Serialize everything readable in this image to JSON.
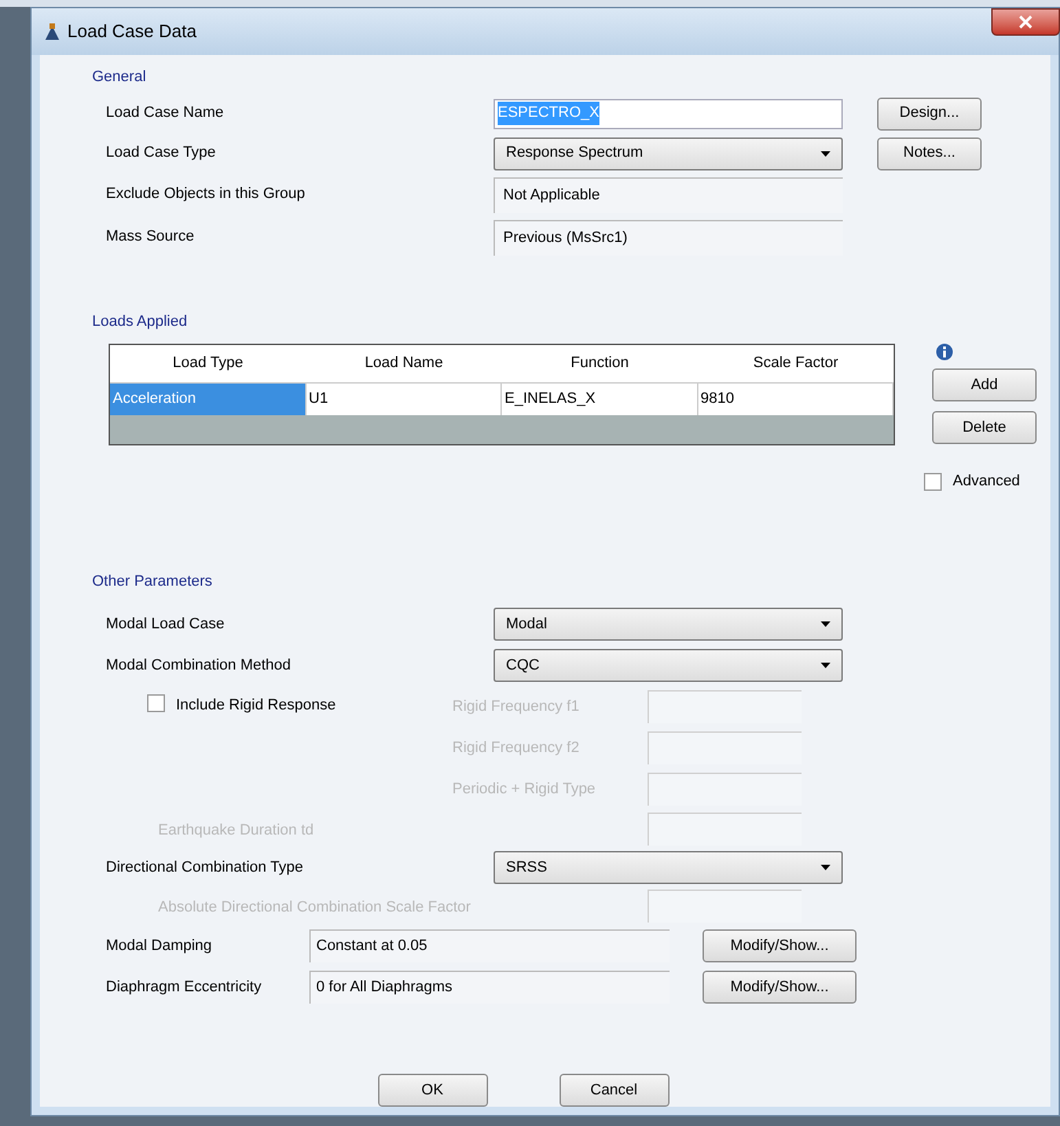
{
  "window": {
    "title": "Load Case Data"
  },
  "general": {
    "title": "General",
    "rows": [
      {
        "kind": "text",
        "label": "Load Case Name",
        "value": "ESPECTRO_X",
        "text_selected": true,
        "button": "Design..."
      },
      {
        "kind": "select",
        "label": "Load Case Type",
        "value": "Response Spectrum",
        "button": "Notes..."
      },
      {
        "kind": "readonly",
        "label": "Exclude Objects in this Group",
        "value": "Not Applicable"
      },
      {
        "kind": "readonly",
        "label": "Mass Source",
        "value": "Previous (MsSrc1)"
      }
    ]
  },
  "loads_applied": {
    "title": "Loads Applied",
    "columns": [
      "Load Type",
      "Load Name",
      "Function",
      "Scale Factor"
    ],
    "rows": [
      {
        "cells": [
          {
            "text": "Acceleration",
            "selected": true
          },
          {
            "text": "U1",
            "selected": false
          },
          {
            "text": "E_INELAS_X",
            "selected": false
          },
          {
            "text": "9810",
            "selected": false
          }
        ]
      }
    ],
    "buttons": [
      "Add",
      "Delete"
    ],
    "advanced": {
      "label": "Advanced",
      "checked": false
    }
  },
  "other_parameters": {
    "title": "Other Parameters",
    "modal_load_case": {
      "label": "Modal Load Case",
      "value": "Modal"
    },
    "modal_combination_method": {
      "label": "Modal Combination Method",
      "value": "CQC"
    },
    "include_rigid_response": {
      "label": "Include Rigid Response",
      "checked": false
    },
    "rigid_fields": [
      {
        "label": "Rigid Frequency f1",
        "disabled": true
      },
      {
        "label": "Rigid Frequency f2",
        "disabled": true
      },
      {
        "label": "Periodic + Rigid Type",
        "disabled": true
      }
    ],
    "earthquake_duration": {
      "label": "Earthquake Duration td",
      "disabled": true
    },
    "directional_combination_type": {
      "label": "Directional Combination Type",
      "value": "SRSS"
    },
    "absolute_scale_factor": {
      "label": "Absolute Directional Combination Scale Factor",
      "disabled": true
    },
    "modal_damping": {
      "label": "Modal Damping",
      "value": "Constant at 0.05",
      "button": "Modify/Show..."
    },
    "diaphragm_eccentricity": {
      "label": "Diaphragm Eccentricity",
      "value": "0 for All Diaphragms",
      "button": "Modify/Show..."
    }
  },
  "buttons": [
    "OK",
    "Cancel"
  ]
}
